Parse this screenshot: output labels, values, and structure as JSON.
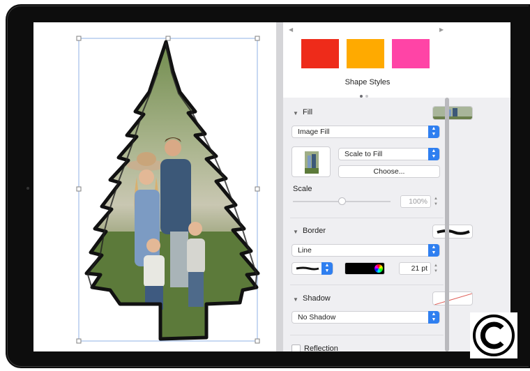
{
  "shape_styles": {
    "label": "Shape Styles",
    "swatches": [
      "#ee2b1a",
      "#ffaa00",
      "#ff44a6"
    ],
    "prev_arrow": "◀",
    "next_arrow": "▶"
  },
  "fill": {
    "title": "Fill",
    "type": "Image Fill",
    "scaling": "Scale to Fill",
    "choose_label": "Choose...",
    "scale_label": "Scale",
    "scale_value": "100%",
    "scale_percent": 100
  },
  "border": {
    "title": "Border",
    "type": "Line",
    "color": "#000000",
    "width": "21 pt"
  },
  "shadow": {
    "title": "Shadow",
    "type": "No Shadow"
  },
  "reflection": {
    "label": "Reflection"
  },
  "icons": {
    "disclosure": "▼",
    "up": "▲",
    "down": "▼",
    "copyright": "©"
  }
}
